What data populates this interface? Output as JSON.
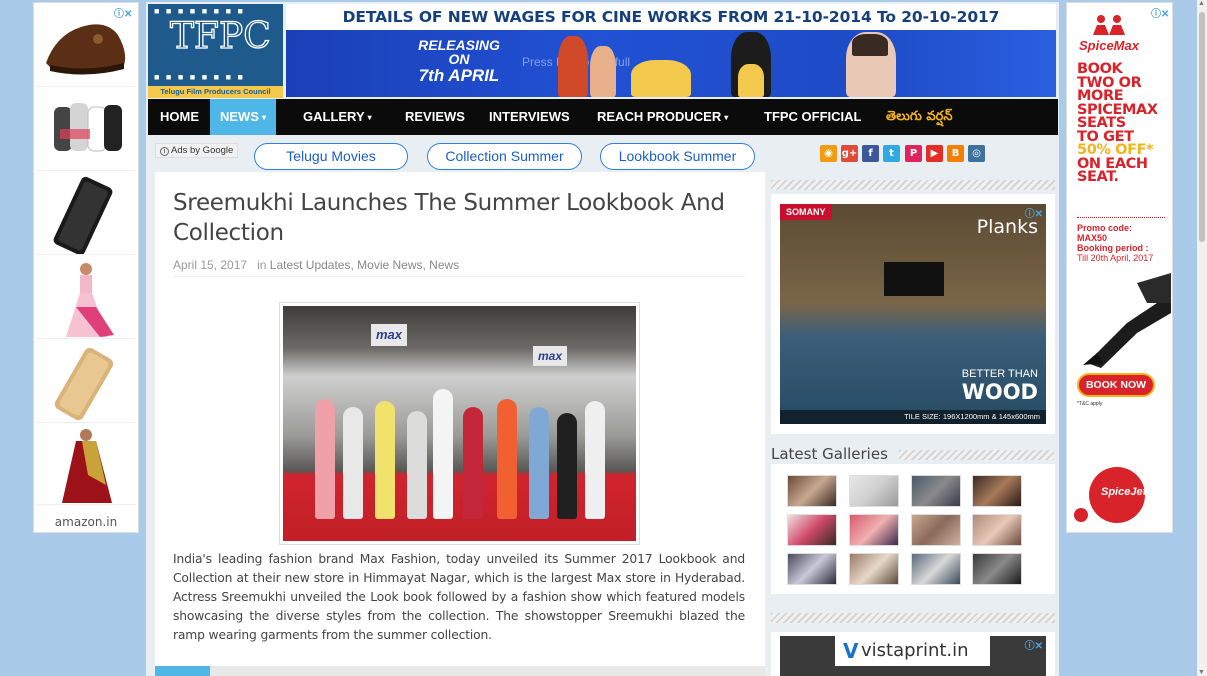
{
  "left_ad": {
    "brand": "amazon.in",
    "products": [
      "brown-shoe",
      "socks-pack",
      "black-phone-case",
      "pink-lehenga",
      "gold-phone-case",
      "red-saree"
    ]
  },
  "right_ad": {
    "logo": "SpiceMax",
    "headline_lines": [
      "BOOK",
      "TWO OR",
      "MORE",
      "SPICEMAX",
      "SEATS",
      "TO GET",
      "50% OFF*",
      "ON EACH",
      "SEAT."
    ],
    "promo_label": "Promo code:",
    "promo_code": "MAX50",
    "booking_label": "Booking period :",
    "booking_value": "Till 20th April, 2017",
    "cta": "BOOK NOW",
    "tc": "*T&C apply",
    "footer_logo": "SpiceJet"
  },
  "header": {
    "logo_text": "TFPC",
    "logo_caption": "Telugu Film Producers Council",
    "notice": "DETAILS OF NEW WAGES FOR CINE WORKS FROM 21-10-2014 To 20-10-2017",
    "banner": {
      "line1": "RELEASING",
      "line2": "ON",
      "line3": "7th APRIL",
      "overlay": "Press Esc to exit full"
    }
  },
  "nav": {
    "items": [
      {
        "label": "HOME",
        "dropdown": false
      },
      {
        "label": "NEWS",
        "dropdown": true
      },
      {
        "label": "GALLERY",
        "dropdown": true
      },
      {
        "label": "REVIEWS",
        "dropdown": false
      },
      {
        "label": "INTERVIEWS",
        "dropdown": false
      },
      {
        "label": "REACH PRODUCER",
        "dropdown": true
      },
      {
        "label": "TFPC OFFICIAL",
        "dropdown": false
      },
      {
        "label": "తెలుగు వర్షన్",
        "dropdown": false
      }
    ],
    "active": "NEWS",
    "caret": "▾"
  },
  "ads_strip": {
    "label": "Ads by Google",
    "links": [
      "Telugu Movies",
      "Collection Summer",
      "Lookbook Summer"
    ]
  },
  "social_icons": [
    {
      "name": "rss-icon",
      "glyph": "◉",
      "color": "#f39c12"
    },
    {
      "name": "googleplus-icon",
      "glyph": "g+",
      "color": "#dd4b39"
    },
    {
      "name": "facebook-icon",
      "glyph": "f",
      "color": "#3b5998"
    },
    {
      "name": "twitter-icon",
      "glyph": "t",
      "color": "#2fa9e0"
    },
    {
      "name": "pinterest-icon",
      "glyph": "P",
      "color": "#e0245e"
    },
    {
      "name": "youtube-icon",
      "glyph": "▶",
      "color": "#e52d27"
    },
    {
      "name": "blogger-icon",
      "glyph": "B",
      "color": "#f57d00"
    },
    {
      "name": "instagram-icon",
      "glyph": "◎",
      "color": "#3f729b"
    }
  ],
  "article": {
    "title": "Sreemukhi Launches The Summer Lookbook And Collection",
    "date": "April 15, 2017",
    "in_label": "in",
    "categories": "Latest Updates, Movie News, News",
    "photo_sign": "max",
    "body": "India's leading fashion brand Max Fashion, today unveiled its Summer 2017 Lookbook and Collection at their new store in Himmayat Nagar, which is the largest Max store in Hyderabad. Actress Sreemukhi unveiled the Look book followed by a fashion show which featured models showcasing the diverse styles from the collection. The showstopper Sreemukhi blazed the ramp wearing garments from the summer collection."
  },
  "sidebar": {
    "ad1": {
      "brand": "SOMANY",
      "product": "Planks",
      "tag1": "BETTER THAN",
      "tag2": "WOOD",
      "tile_info": "TILE SIZE: 196X1200mm & 145x600mm"
    },
    "latest_galleries_title": "Latest Galleries",
    "gallery_count": 12,
    "ad2_brand": "vistaprint.in"
  },
  "colors": {
    "page_bg": "#a9cbe9",
    "nav_bg": "#0b0b0b",
    "nav_active": "#4fb6e8",
    "notice_text": "#16407b",
    "spicemax_red": "#d8232a",
    "telugu_link": "#f2b31b"
  }
}
